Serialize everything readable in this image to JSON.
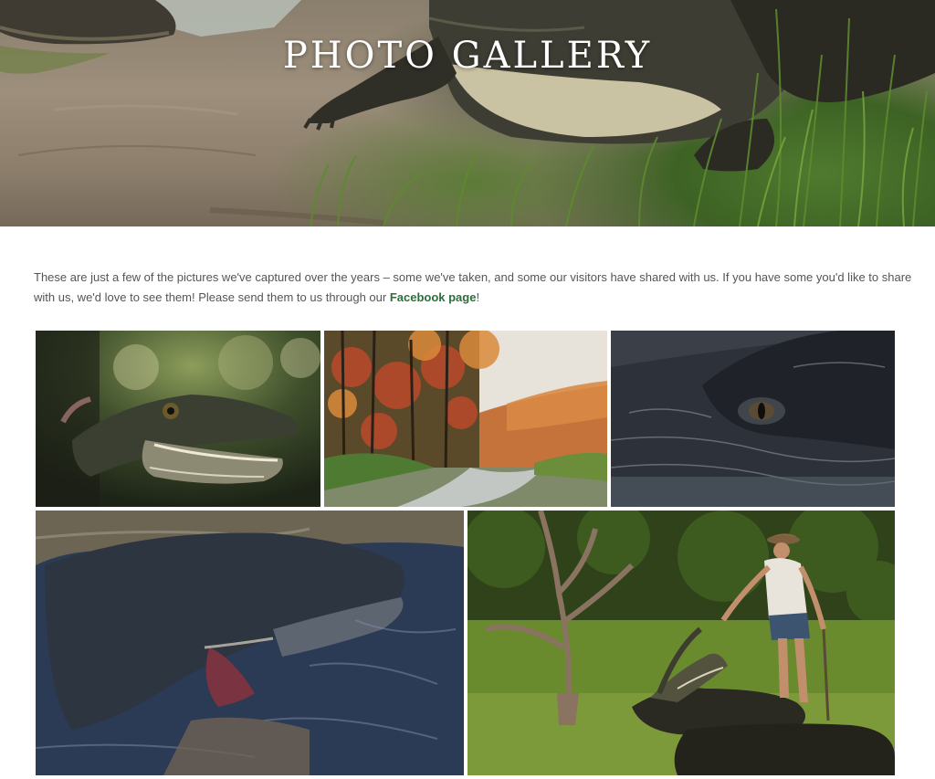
{
  "hero": {
    "title": "PHOTO GALLERY"
  },
  "intro": {
    "text_before_link": "These are just a few of the pictures we've captured over the years – some we've taken, and some our visitors have shared with us. If you have some you'd like to share with us, we'd love to see them! Please send them to us through our ",
    "link_label": "Facebook page",
    "text_after_link": "!",
    "link_color": "#2c6e39"
  },
  "gallery": {
    "photos": [
      {
        "subject": "young alligator with open mouth"
      },
      {
        "subject": "swamp creek with autumn trees"
      },
      {
        "subject": "alligator eye close-up"
      },
      {
        "subject": "alligator head in water"
      },
      {
        "subject": "man in hat feeding alligators"
      }
    ]
  }
}
